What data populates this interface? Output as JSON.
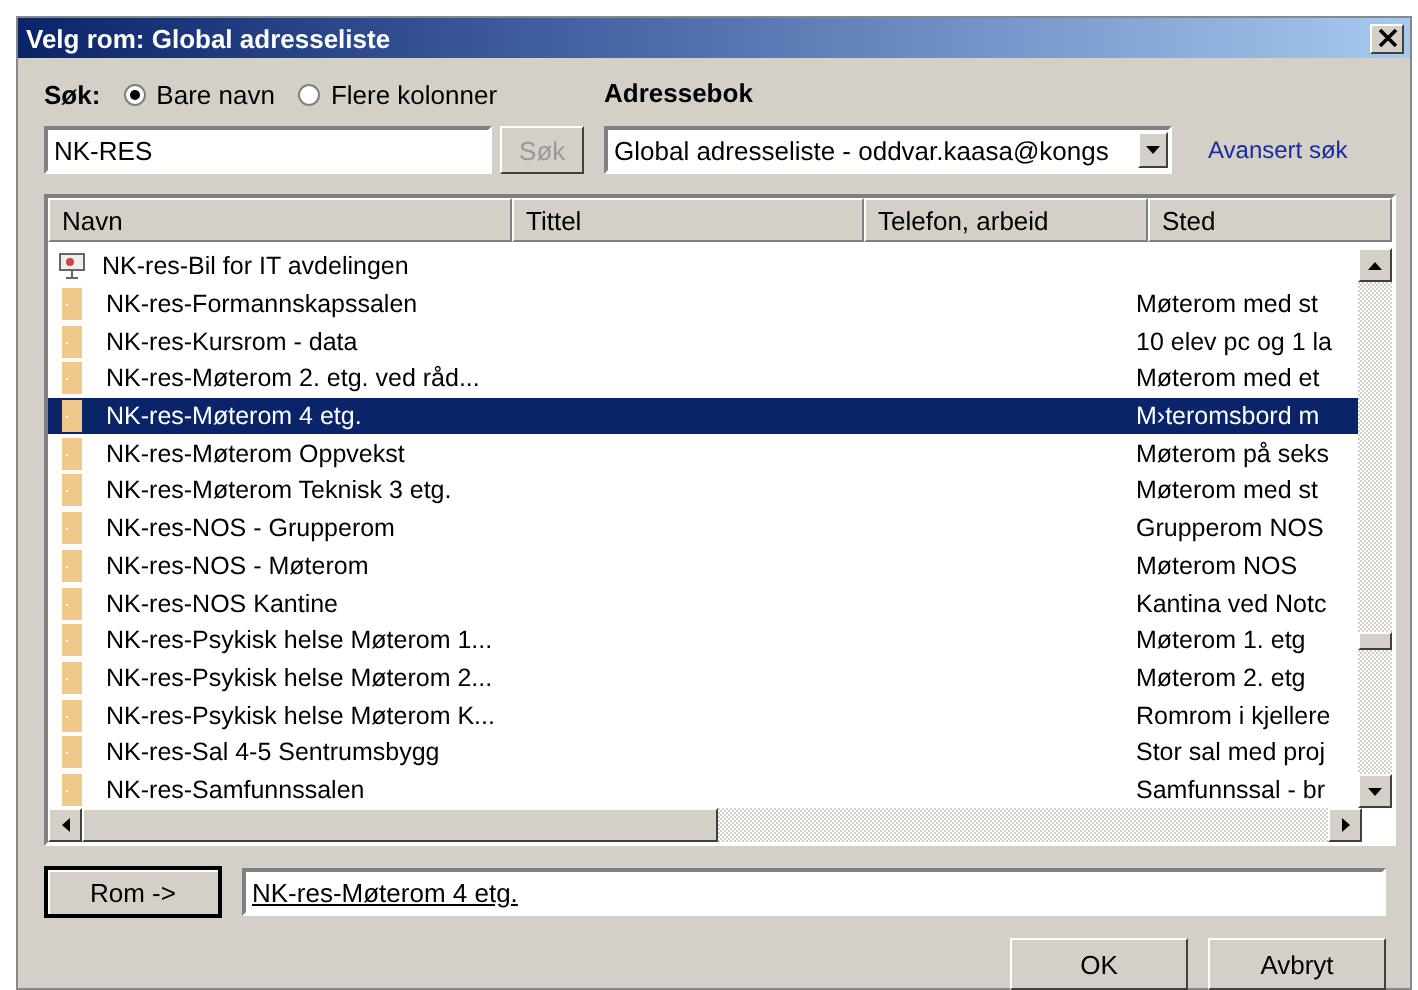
{
  "window": {
    "title": "Velg rom: Global adresseliste"
  },
  "search": {
    "label": "Søk:",
    "options": [
      {
        "label": "Bare navn",
        "selected": true
      },
      {
        "label": "Flere kolonner",
        "selected": false
      }
    ],
    "value": "NK-RES",
    "button": "Søk",
    "button_disabled": true
  },
  "addressbook": {
    "label": "Adressebok",
    "value": "Global adresseliste - oddvar.kaasa@kongs",
    "advanced_link": "Avansert søk"
  },
  "table": {
    "columns": [
      "Navn",
      "Tittel",
      "Telefon, arbeid",
      "Sted"
    ],
    "rows": [
      {
        "kind": "device",
        "name": "NK-res-Bil for IT avdelingen",
        "location": "",
        "selected": false
      },
      {
        "kind": "room",
        "name": "NK-res-Formannskapssalen",
        "location": "Møterom med st",
        "selected": false
      },
      {
        "kind": "room",
        "name": "NK-res-Kursrom - data",
        "location": "10 elev pc og 1 la",
        "selected": false
      },
      {
        "kind": "room",
        "name": "NK-res-Møterom 2. etg. ved råd...",
        "location": "Møterom med et",
        "selected": false
      },
      {
        "kind": "room",
        "name": "NK-res-Møterom 4 etg.",
        "location": "M›teromsbord m",
        "selected": true
      },
      {
        "kind": "room",
        "name": "NK-res-Møterom Oppvekst",
        "location": "Møterom på seks",
        "selected": false
      },
      {
        "kind": "room",
        "name": "NK-res-Møterom Teknisk 3 etg.",
        "location": "Møterom med st",
        "selected": false
      },
      {
        "kind": "room",
        "name": "NK-res-NOS - Grupperom",
        "location": "Grupperom NOS",
        "selected": false
      },
      {
        "kind": "room",
        "name": "NK-res-NOS - Møterom",
        "location": "Møterom NOS",
        "selected": false
      },
      {
        "kind": "room",
        "name": "NK-res-NOS Kantine",
        "location": "Kantina ved Notc",
        "selected": false
      },
      {
        "kind": "room",
        "name": "NK-res-Psykisk helse Møterom 1...",
        "location": "Møterom 1. etg",
        "selected": false
      },
      {
        "kind": "room",
        "name": "NK-res-Psykisk helse Møterom 2...",
        "location": "Møterom 2. etg",
        "selected": false
      },
      {
        "kind": "room",
        "name": "NK-res-Psykisk helse Møterom K...",
        "location": "Romrom i kjellere",
        "selected": false
      },
      {
        "kind": "room",
        "name": "NK-res-Sal 4-5 Sentrumsbygg",
        "location": "Stor sal med proj",
        "selected": false
      },
      {
        "kind": "room",
        "name": "NK-res-Samfunnssalen",
        "location": "Samfunnssal - br",
        "selected": false
      }
    ]
  },
  "room_button": "Rom ->",
  "room_value": "NK-res-Møterom 4 etg.",
  "buttons": [
    "OK",
    "Avbryt"
  ]
}
